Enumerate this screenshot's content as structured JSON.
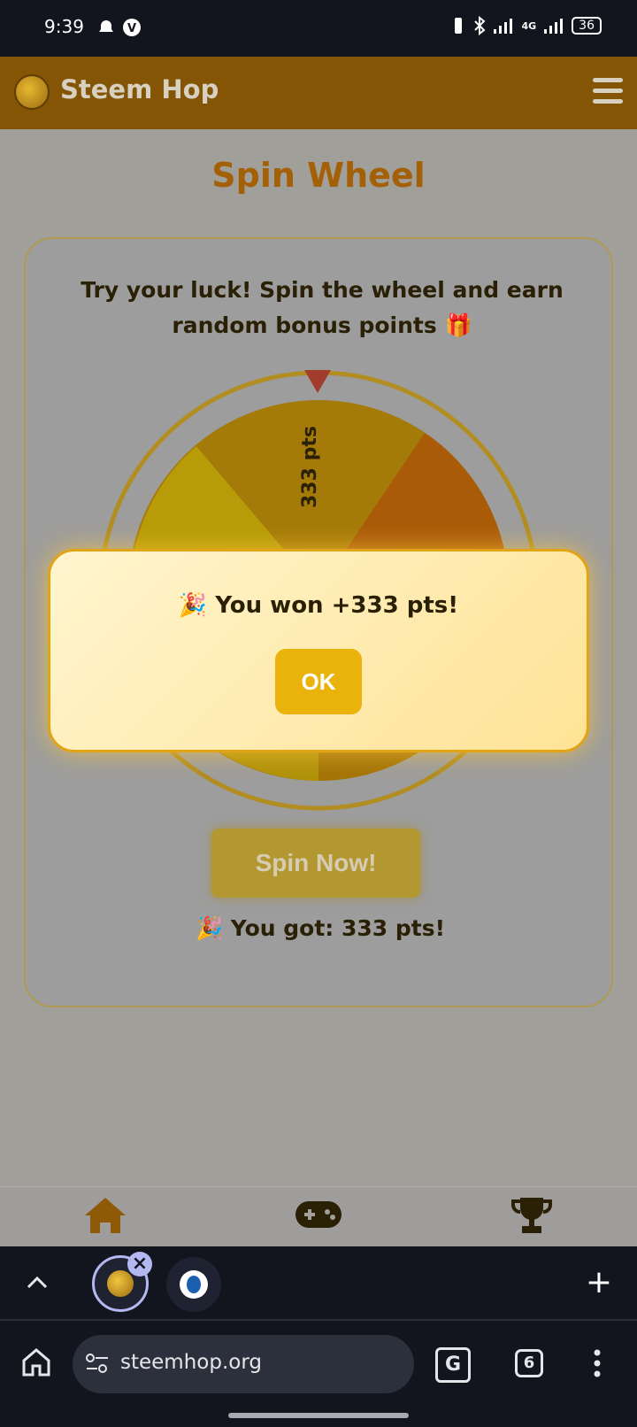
{
  "status_bar": {
    "time": "9:39",
    "network": "4G",
    "battery": "36"
  },
  "app_bar": {
    "title": "Steem Hop",
    "logo_text": "STEEM HOP"
  },
  "page": {
    "title": "Spin Wheel",
    "intro": "Try your luck! Spin the wheel and earn random bonus points 🎁",
    "wheel_labels": [
      "333 pts"
    ],
    "spin_button": "Spin Now!",
    "result": "🎉 You got: 333 pts!"
  },
  "dialog": {
    "message": "🎉 You won +333 pts!",
    "ok_label": "OK"
  },
  "browser": {
    "url": "steemhop.org",
    "tab_count": "6",
    "new_tab_label": "+"
  },
  "colors": {
    "app_bar": "#835505",
    "accent": "#e9b30c",
    "title": "#a36007"
  }
}
